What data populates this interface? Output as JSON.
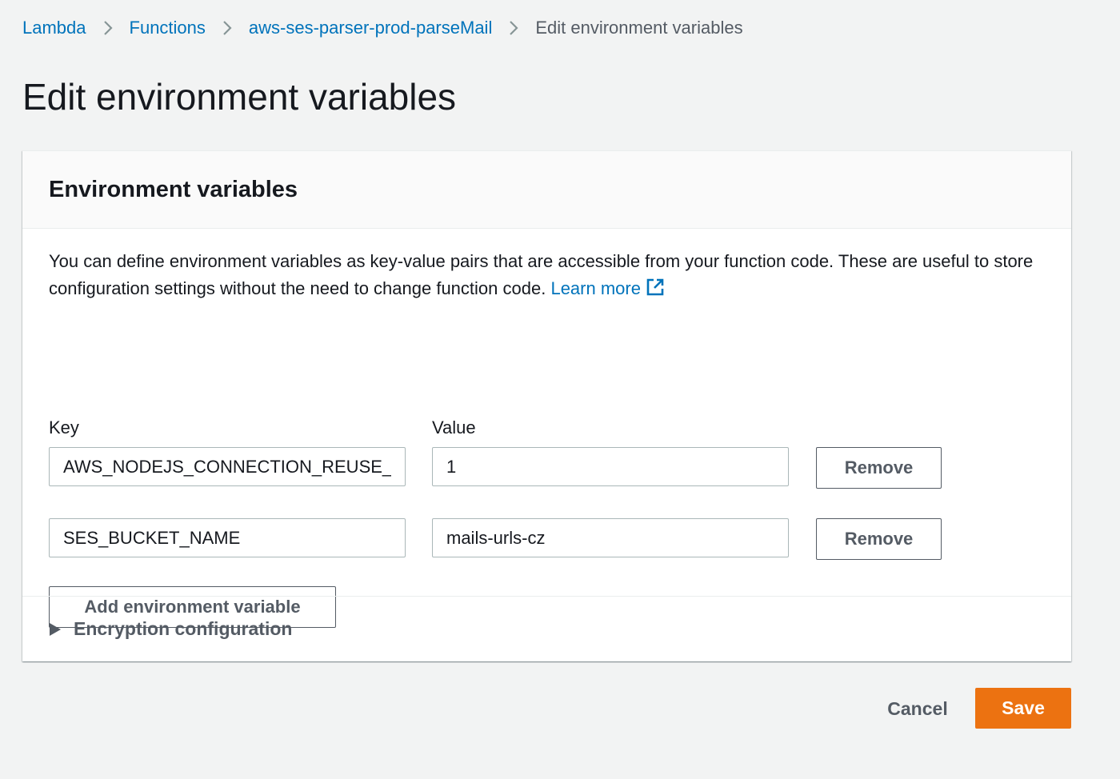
{
  "breadcrumb": {
    "items": [
      "Lambda",
      "Functions",
      "aws-ses-parser-prod-parseMail"
    ],
    "current": "Edit environment variables"
  },
  "page": {
    "title": "Edit environment variables"
  },
  "panel": {
    "title": "Environment variables",
    "description": "You can define environment variables as key-value pairs that are accessible from your function code. These are useful to store configuration settings without the need to change function code.",
    "learn_more": "Learn more",
    "key_label": "Key",
    "value_label": "Value",
    "rows": [
      {
        "key": "AWS_NODEJS_CONNECTION_REUSE_EI",
        "value": "1",
        "remove_label": "Remove"
      },
      {
        "key": "SES_BUCKET_NAME",
        "value": "mails-urls-cz",
        "remove_label": "Remove"
      }
    ],
    "add_label": "Add environment variable",
    "encryption_label": "Encryption configuration"
  },
  "actions": {
    "cancel": "Cancel",
    "save": "Save"
  },
  "colors": {
    "link": "#0073bb",
    "primary": "#ec7211",
    "background": "#f2f3f3"
  },
  "icons": {
    "separator": "chevron-right-icon",
    "external": "external-link-icon",
    "expand": "caret-right-icon"
  }
}
